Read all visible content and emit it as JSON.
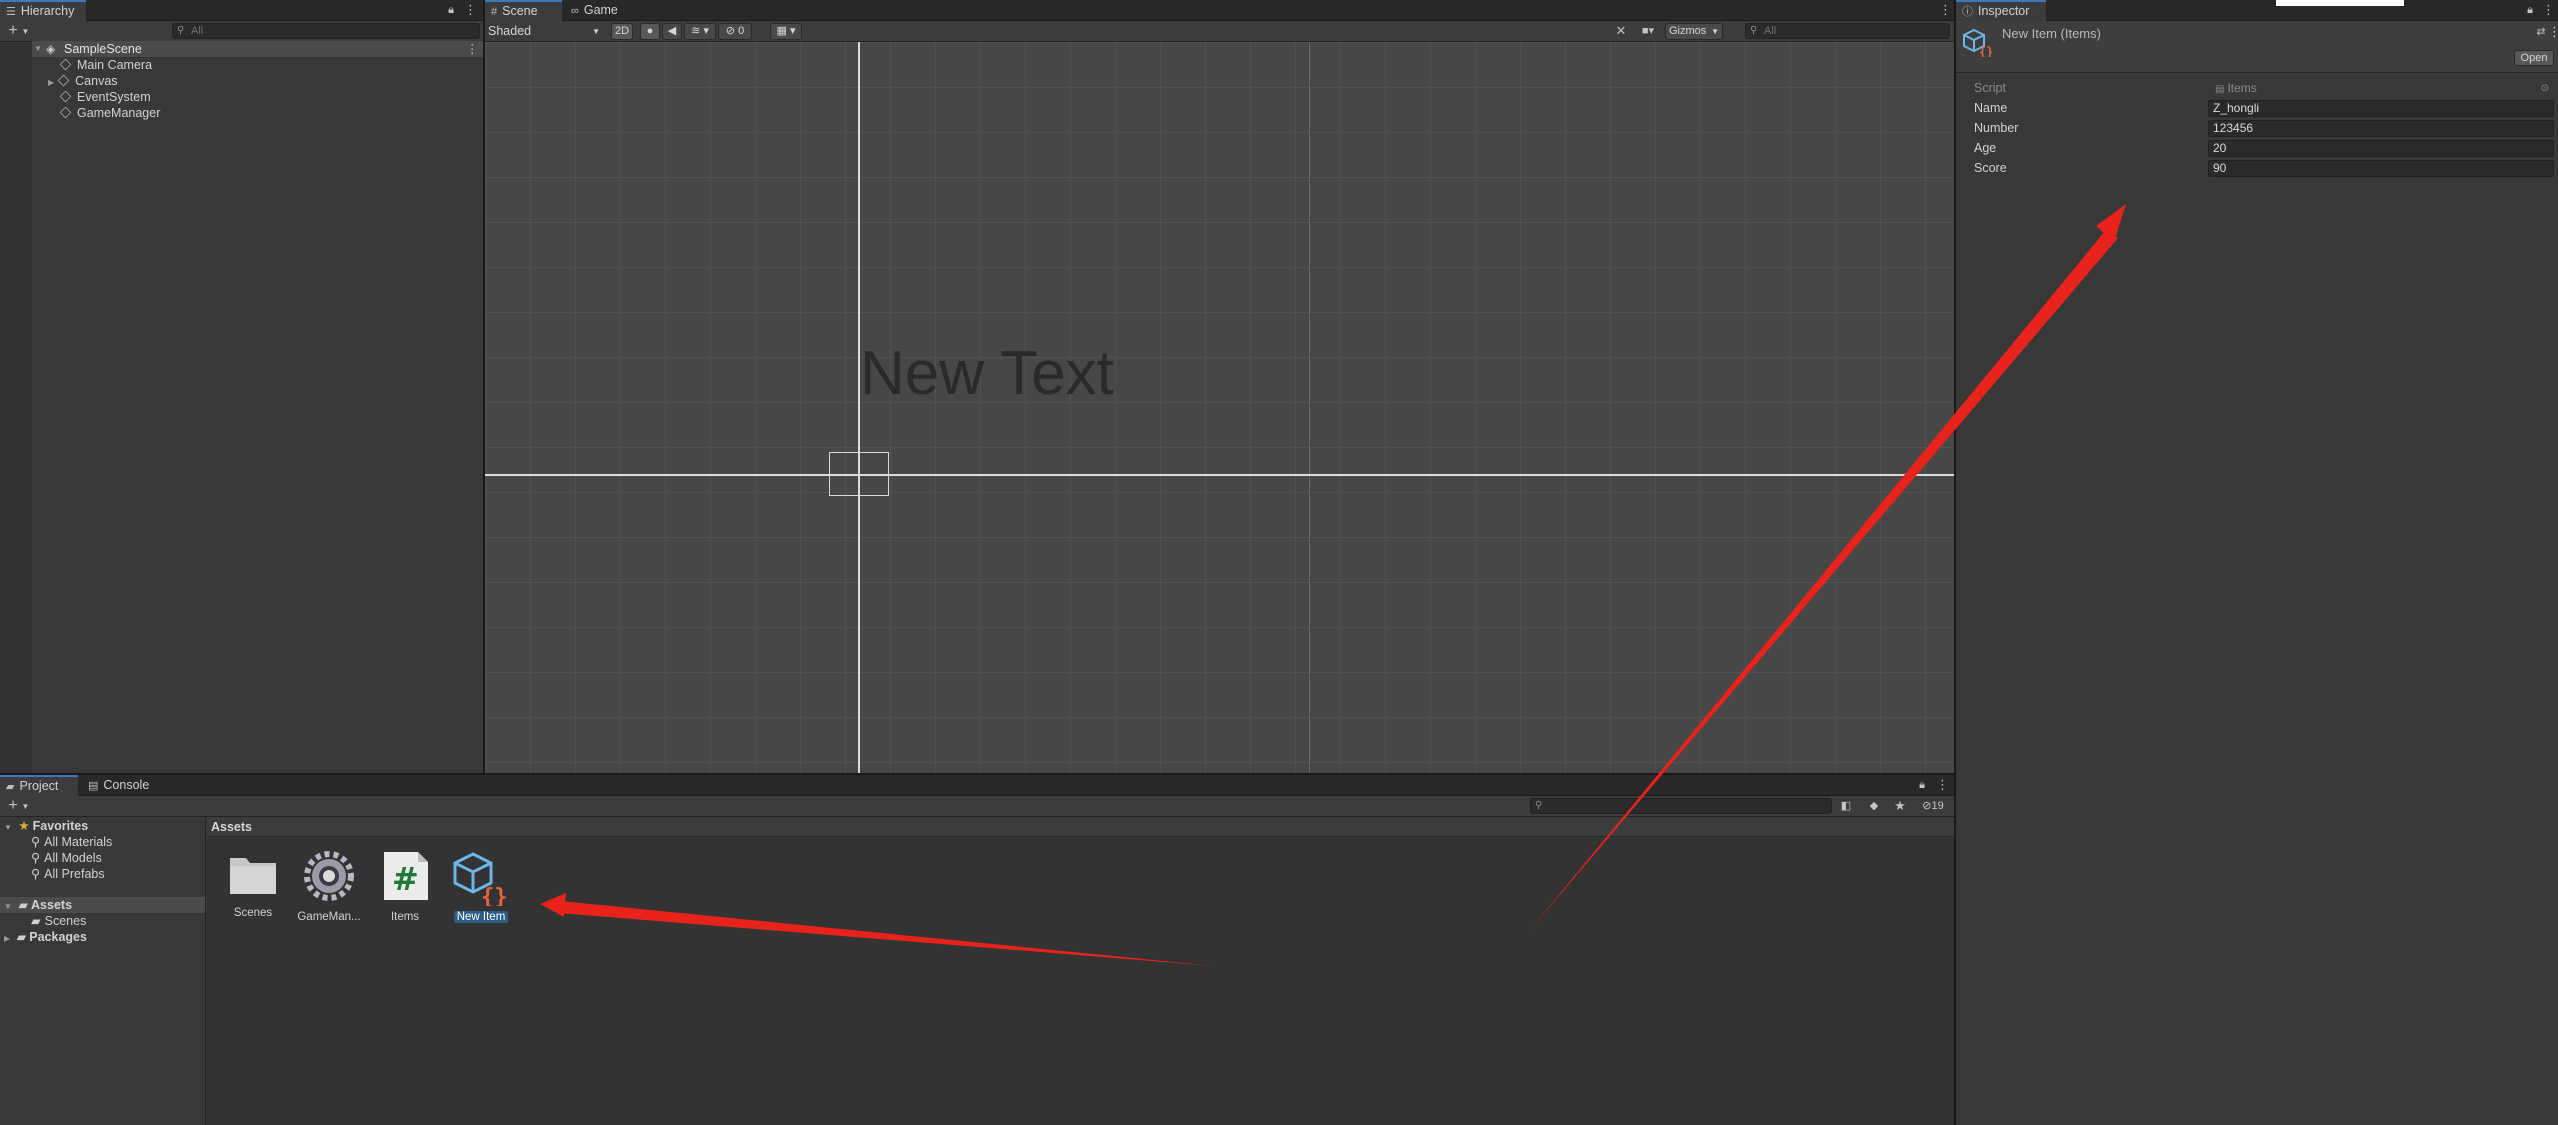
{
  "hierarchy": {
    "tab": "Hierarchy",
    "search_placeholder": "All",
    "scene": "SampleScene",
    "items": [
      "Main Camera",
      "Canvas",
      "EventSystem",
      "GameManager"
    ]
  },
  "scene_view": {
    "tabs": [
      "Scene",
      "Game"
    ],
    "shading": "Shaded",
    "mode_2d": "2D",
    "hidden_count": "0",
    "gizmos": "Gizmos",
    "search_placeholder": "All",
    "canvas_text": "New Text"
  },
  "inspector": {
    "tab": "Inspector",
    "title": "New Item (Items)",
    "open_button": "Open",
    "script_label": "Script",
    "script_value": "Items",
    "fields": [
      {
        "label": "Name",
        "value": "Z_hongli"
      },
      {
        "label": "Number",
        "value": "123456"
      },
      {
        "label": "Age",
        "value": "20"
      },
      {
        "label": "Score",
        "value": "90"
      }
    ]
  },
  "project": {
    "tabs": [
      "Project",
      "Console"
    ],
    "visible_count": "19",
    "favorites_label": "Favorites",
    "favorites": [
      "All Materials",
      "All Models",
      "All Prefabs"
    ],
    "assets_label": "Assets",
    "assets_children": [
      "Scenes"
    ],
    "packages_label": "Packages",
    "breadcrumb": "Assets",
    "assets": [
      {
        "name": "Scenes",
        "icon": "folder-icon"
      },
      {
        "name": "GameMan...",
        "icon": "gear-icon"
      },
      {
        "name": "Items",
        "icon": "csharp-script-icon"
      },
      {
        "name": "New Item",
        "icon": "scriptable-object-icon",
        "selected": true
      }
    ]
  },
  "colors": {
    "accent": "#3a79bb",
    "selection": "#2c5d87",
    "arrow": "#e8231b"
  }
}
